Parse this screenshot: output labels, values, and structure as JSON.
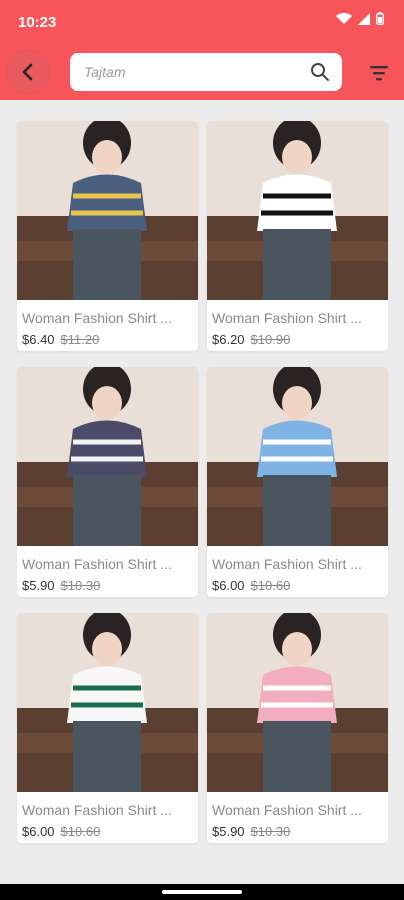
{
  "status": {
    "time": "10:23"
  },
  "search": {
    "placeholder": "",
    "value": "Tajtam"
  },
  "colors": {
    "accent": "#f6555a"
  },
  "products": [
    {
      "name": "Woman Fashion Shirt ...",
      "price": "$6.40",
      "old_price": "$11.20",
      "top": "#4a5f7e",
      "accent": "#e6c44d"
    },
    {
      "name": "Woman Fashion Shirt ...",
      "price": "$6.20",
      "old_price": "$10.90",
      "top": "#ffffff",
      "accent": "#111111"
    },
    {
      "name": "Woman Fashion Shirt ...",
      "price": "$5.90",
      "old_price": "$10.30",
      "top": "#4b4b68",
      "accent": "#f3f3f3"
    },
    {
      "name": "Woman Fashion Shirt ...",
      "price": "$6.00",
      "old_price": "$10.60",
      "top": "#7fb3e3",
      "accent": "#ffffff"
    },
    {
      "name": "Woman Fashion Shirt ...",
      "price": "$6.00",
      "old_price": "$10.60",
      "top": "#f7f7f7",
      "accent": "#1b6e4b"
    },
    {
      "name": "Woman Fashion Shirt ...",
      "price": "$5.90",
      "old_price": "$10.30",
      "top": "#f2aebf",
      "accent": "#ffffff"
    }
  ]
}
